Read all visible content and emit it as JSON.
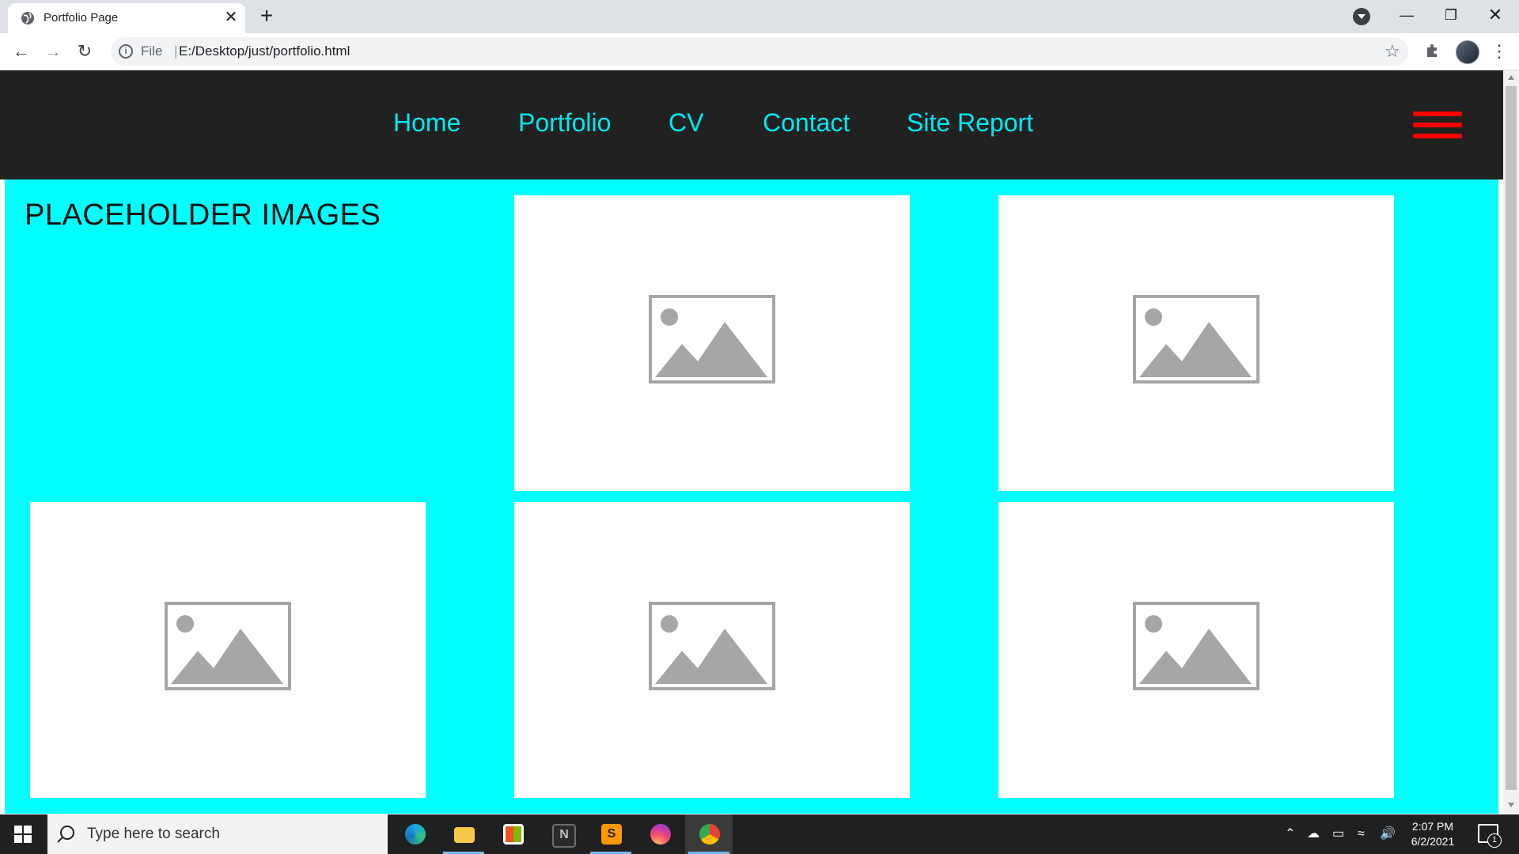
{
  "browser": {
    "tab_title": "Portfolio Page",
    "new_tab_glyph": "+",
    "close_glyph": "✕",
    "address_scheme": "File",
    "address_separator": "|",
    "address_url": "E:/Desktop/just/portfolio.html",
    "window_controls": {
      "minimize": "—",
      "maximize": "❐",
      "close": "✕"
    }
  },
  "site": {
    "nav": [
      "Home",
      "Portfolio",
      "CV",
      "Contact",
      "Site Report"
    ],
    "heading": "PLACEHOLDER IMAGES",
    "placeholder_count": 5,
    "colors": {
      "header_bg": "#222121",
      "nav_text": "#00e9f0",
      "content_bg": "#00ffff",
      "hamburger": "#ff0000"
    }
  },
  "taskbar": {
    "search_placeholder": "Type here to search",
    "apps": [
      "edge-icon",
      "file-explorer-icon",
      "store-icon",
      "notepad-icon",
      "sublime-text-icon",
      "instagram-icon",
      "chrome-icon"
    ],
    "time": "2:07 PM",
    "date": "6/2/2021",
    "notification_count": "1"
  }
}
